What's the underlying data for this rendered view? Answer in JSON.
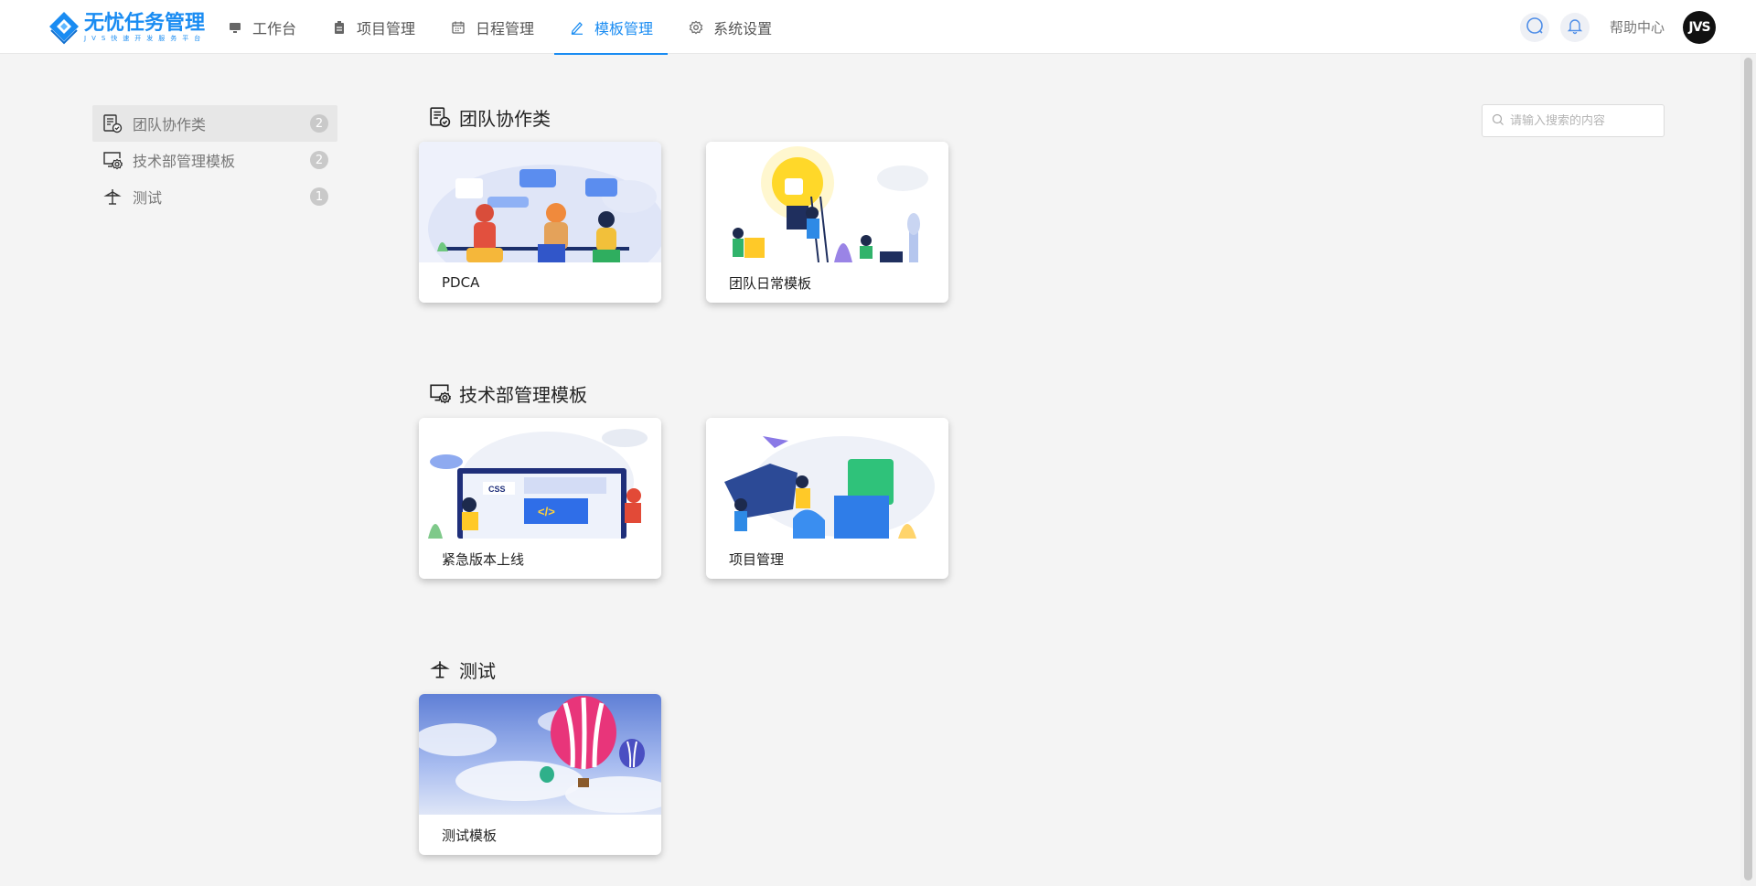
{
  "header": {
    "logo": {
      "title": "无忧任务管理",
      "subtitle": "JVS快速开发服务平台"
    },
    "nav": [
      {
        "label": "工作台",
        "icon": "monitor-icon"
      },
      {
        "label": "项目管理",
        "icon": "clipboard-icon"
      },
      {
        "label": "日程管理",
        "icon": "calendar-icon"
      },
      {
        "label": "模板管理",
        "icon": "pen-icon",
        "active": true
      },
      {
        "label": "系统设置",
        "icon": "gear-icon"
      }
    ],
    "help_label": "帮助中心",
    "avatar_text": "JVS"
  },
  "sidebar": {
    "items": [
      {
        "label": "团队协作类",
        "count": "2",
        "icon": "team-doc-icon",
        "active": true
      },
      {
        "label": "技术部管理模板",
        "count": "2",
        "icon": "monitor-gear-icon"
      },
      {
        "label": "测试",
        "count": "1",
        "icon": "signpost-icon"
      }
    ]
  },
  "search": {
    "placeholder": "请输入搜索的内容"
  },
  "sections": [
    {
      "title": "团队协作类",
      "cards": [
        {
          "label": "PDCA"
        },
        {
          "label": "团队日常模板"
        }
      ]
    },
    {
      "title": "技术部管理模板",
      "cards": [
        {
          "label": "紧急版本上线"
        },
        {
          "label": "项目管理"
        }
      ]
    },
    {
      "title": "测试",
      "cards": [
        {
          "label": "测试模板"
        }
      ]
    }
  ],
  "colors": {
    "accent": "#1a8cf2",
    "background": "#f4f4f4"
  }
}
